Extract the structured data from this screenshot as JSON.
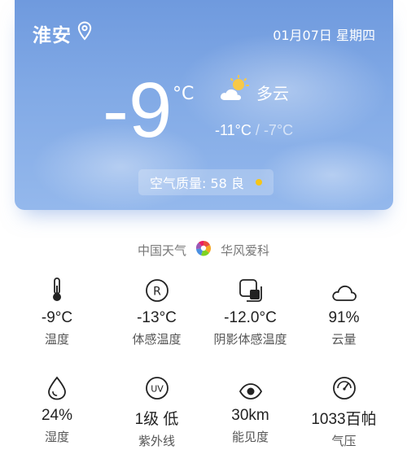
{
  "header": {
    "city": "淮安",
    "date": "01月07日 星期四"
  },
  "current": {
    "temperature": "-9",
    "unit": "°C",
    "condition": "多云",
    "low": "-11°C",
    "separator": "/",
    "high": "-7°C",
    "aqi_label": "空气质量: 58 良",
    "aqi_color": "#f5c518"
  },
  "source": {
    "left": "中国天气",
    "right": "华风爱科"
  },
  "details": [
    {
      "icon": "thermometer-icon",
      "value": "-9°C",
      "label": "温度"
    },
    {
      "icon": "feels-like-icon",
      "value": "-13°C",
      "label": "体感温度"
    },
    {
      "icon": "shade-icon",
      "value": "-12.0°C",
      "label": "阴影体感温度"
    },
    {
      "icon": "cloud-icon",
      "value": "91%",
      "label": "云量"
    },
    {
      "icon": "humidity-icon",
      "value": "24%",
      "label": "湿度"
    },
    {
      "icon": "uv-icon",
      "value": "1级 低",
      "label": "紫外线"
    },
    {
      "icon": "eye-icon",
      "value": "30km",
      "label": "能见度"
    },
    {
      "icon": "gauge-icon",
      "value": "1033百帕",
      "label": "气压"
    }
  ],
  "colors": {
    "card_top": "#6f9ade",
    "card_bottom": "#94b8ec",
    "sun": "#f7c948"
  }
}
